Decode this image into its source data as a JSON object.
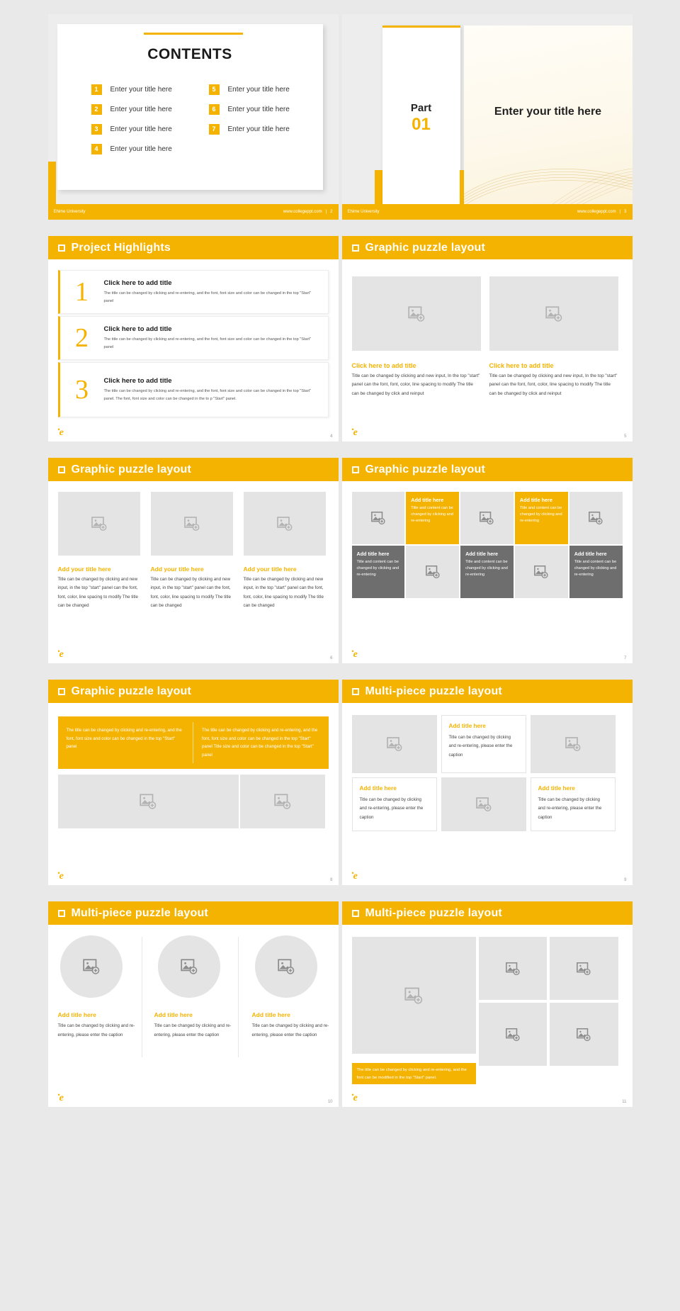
{
  "theme": {
    "accent": "#F5B301",
    "gray": "#6e6e6e",
    "placeholder": "#e4e4e4"
  },
  "footer": {
    "org": "Ehime University",
    "url": "www.collegeppt.com",
    "divider": "|"
  },
  "slides": [
    {
      "page": "2",
      "title": "CONTENTS",
      "items": [
        {
          "num": "1",
          "label": "Enter your title here"
        },
        {
          "num": "5",
          "label": "Enter your title here"
        },
        {
          "num": "2",
          "label": "Enter your title here"
        },
        {
          "num": "6",
          "label": "Enter your title here"
        },
        {
          "num": "3",
          "label": "Enter your title here"
        },
        {
          "num": "7",
          "label": "Enter your title here"
        },
        {
          "num": "4",
          "label": "Enter your title here"
        }
      ]
    },
    {
      "page": "3",
      "part_label": "Part",
      "part_number": "01",
      "title": "Enter your title here"
    },
    {
      "page": "4",
      "header": "Project Highlights",
      "items": [
        {
          "num": "1",
          "title": "Click here to add title",
          "body": "The title can be changed by clicking and re-entering, and the font, font size and color can be changed in the top \"Start\" panel"
        },
        {
          "num": "2",
          "title": "Click here to add title",
          "body": "The title can be changed by clicking and re-entering, and the font, font size and color can be changed in the top \"Start\" panel"
        },
        {
          "num": "3",
          "title": "Click here to add title",
          "body": "The title can be changed by clicking and re-entering, and the font, font size and color can be changed in the top \"Start\" panel. The font, font size and color can be changed in the to p \"Start\" panel."
        }
      ]
    },
    {
      "page": "5",
      "header": "Graphic puzzle layout",
      "columns": [
        {
          "caption": "Click here to add title",
          "body": "Title can be changed by clicking and new input, In the top \"start\" panel can the font, font, color, line spacing to modify The title can be changed by click and reinput"
        },
        {
          "caption": "Click here to add title",
          "body": "Title can be changed by clicking and new input, In the top \"start\" panel can the font, font, color, line spacing to modify The title can be changed by click and reinput"
        }
      ]
    },
    {
      "page": "6",
      "header": "Graphic puzzle layout",
      "columns": [
        {
          "caption": "Add your title here",
          "body": "Title can be changed by clicking and new input, in the top \"start\" panel can the font, font, color, line spacing to modify The title can be changed"
        },
        {
          "caption": "Add your title here",
          "body": "Title can be changed by clicking and new input, in the top \"start\" panel can the font, font, color, line spacing to modify The title can be changed"
        },
        {
          "caption": "Add your title here",
          "body": "Title can be changed by clicking and new input, in the top \"start\" panel can the font, font, color, line spacing to modify The title can be changed"
        }
      ]
    },
    {
      "page": "7",
      "header": "Graphic puzzle layout",
      "cells": [
        {
          "type": "image"
        },
        {
          "type": "yellow",
          "title": "Add title here",
          "body": "Title and content can be changed by clicking and re-entering"
        },
        {
          "type": "image"
        },
        {
          "type": "yellow",
          "title": "Add title here",
          "body": "Title and content can be changed by clicking and re-entering"
        },
        {
          "type": "image"
        },
        {
          "type": "gray",
          "title": "Add title here",
          "body": "Title and content can be changed by clicking and re-entering"
        },
        {
          "type": "image"
        },
        {
          "type": "gray",
          "title": "Add title here",
          "body": "Title and content can be changed by clicking and re-entering"
        },
        {
          "type": "image"
        },
        {
          "type": "gray",
          "title": "Add title here",
          "body": "Title and content can be changed by clicking and re-entering"
        }
      ]
    },
    {
      "page": "8",
      "header": "Graphic puzzle layout",
      "band": [
        "The title can be changed by clicking and re-entering, and the font, font size and color can be changed in the top \"Start\" panel",
        "The title can be changed by clicking and re-entering, and the font, font size and color can be changed in the top \"Start\" panel  Title size and color can be changed in the top \"Start\" panel"
      ]
    },
    {
      "page": "9",
      "header": "Multi-piece puzzle layout",
      "boxes": [
        {
          "caption": "Add title here",
          "body": "Title can be changed by clicking and re-entering, please enter the caption"
        },
        {
          "caption": "Add title here",
          "body": "Title can be changed by clicking and re-entering, please enter the caption"
        },
        {
          "caption": "Add title here",
          "body": "Title can be changed by clicking and re-entering, please enter the caption"
        }
      ]
    },
    {
      "page": "10",
      "header": "Multi-piece puzzle layout",
      "columns": [
        {
          "caption": "Add title here",
          "body": "Title can be changed by clicking and re-entering, please enter the caption"
        },
        {
          "caption": "Add title here",
          "body": "Title can be changed by clicking and re-entering, please enter the caption"
        },
        {
          "caption": "Add title here",
          "body": "Title can be changed by clicking and re-entering, please enter the caption"
        }
      ]
    },
    {
      "page": "11",
      "header": "Multi-piece puzzle layout",
      "caption": "The title can be changed by clicking and re-entering, and the font can be modified in the top \"Start\" panel."
    }
  ],
  "icons": {
    "image_placeholder": "image-add-icon",
    "header_bullet": "square-outline-icon",
    "logo": "brand-mark-icon"
  }
}
